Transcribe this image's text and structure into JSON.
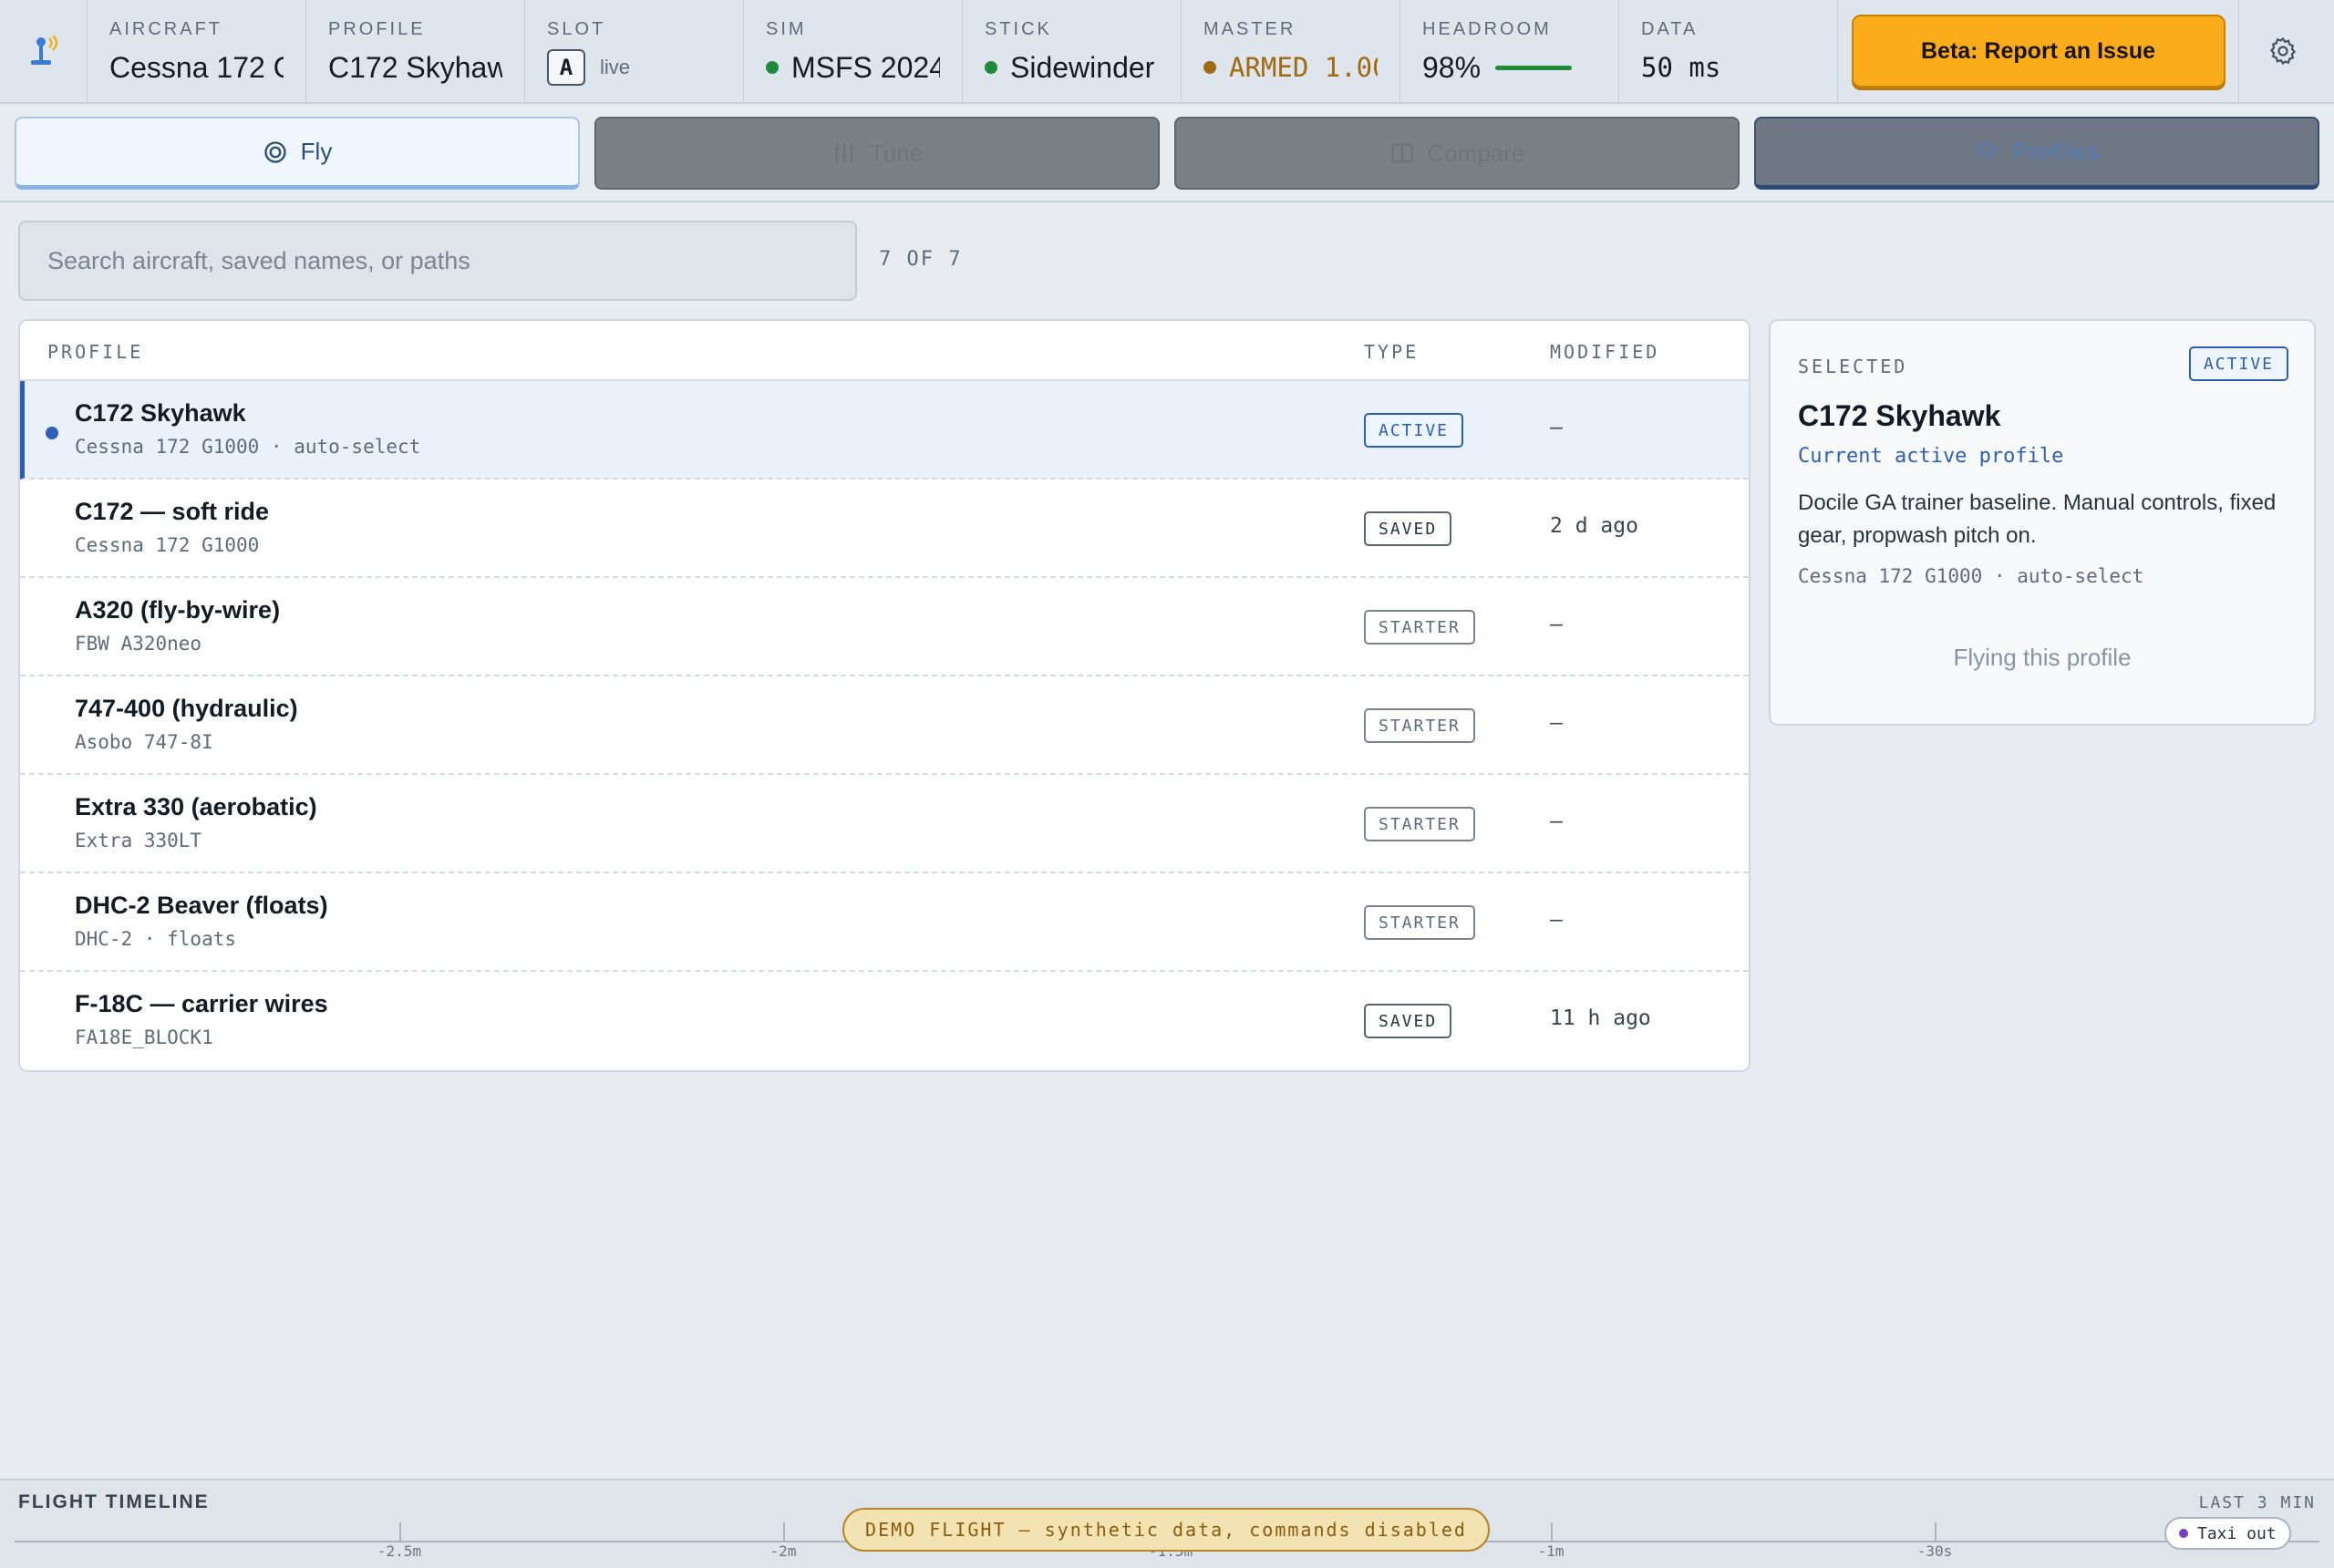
{
  "status": {
    "aircraft": {
      "label": "AIRCRAFT",
      "value": "Cessna 172 G"
    },
    "profile": {
      "label": "PROFILE",
      "value": "C172 Skyhaw"
    },
    "slot": {
      "label": "SLOT",
      "value": "A",
      "state": "live"
    },
    "sim": {
      "label": "SIM",
      "value": "MSFS 2024",
      "dot_color": "#1e8a3a"
    },
    "stick": {
      "label": "STICK",
      "value": "Sidewinder",
      "dot_color": "#1e8a3a"
    },
    "master": {
      "label": "MASTER",
      "value": "ARMED 1.00",
      "dot_color": "#a06a10"
    },
    "headroom": {
      "label": "HEADROOM",
      "value": "98%",
      "level": 0.98
    },
    "data": {
      "label": "DATA",
      "value": "50 ms"
    },
    "report_button": "Beta: Report an Issue"
  },
  "tabs": [
    {
      "label": "Fly",
      "icon": "target-icon"
    },
    {
      "label": "Tune",
      "icon": "sliders-icon"
    },
    {
      "label": "Compare",
      "icon": "columns-icon"
    },
    {
      "label": "Profiles",
      "icon": "layers-icon"
    }
  ],
  "search": {
    "placeholder": "Search aircraft, saved names, or paths",
    "count": "7 OF 7"
  },
  "table": {
    "headers": {
      "profile": "PROFILE",
      "type": "TYPE",
      "modified": "MODIFIED"
    },
    "rows": [
      {
        "name": "C172 Skyhawk",
        "sub": "Cessna 172 G1000 · auto-select",
        "type": "ACTIVE",
        "modified": "—"
      },
      {
        "name": "C172 — soft ride",
        "sub": "Cessna 172 G1000",
        "type": "SAVED",
        "modified": "2 d ago"
      },
      {
        "name": "A320 (fly-by-wire)",
        "sub": "FBW A320neo",
        "type": "STARTER",
        "modified": "—"
      },
      {
        "name": "747-400 (hydraulic)",
        "sub": "Asobo 747-8I",
        "type": "STARTER",
        "modified": "—"
      },
      {
        "name": "Extra 330 (aerobatic)",
        "sub": "Extra 330LT",
        "type": "STARTER",
        "modified": "—"
      },
      {
        "name": "DHC-2 Beaver (floats)",
        "sub": "DHC-2 · floats",
        "type": "STARTER",
        "modified": "—"
      },
      {
        "name": "F-18C — carrier wires",
        "sub": "FA18E_BLOCK1",
        "type": "SAVED",
        "modified": "11 h ago"
      }
    ]
  },
  "panel": {
    "label": "SELECTED",
    "badge": "ACTIVE",
    "title": "C172 Skyhawk",
    "subtitle": "Current active profile",
    "description": "Docile GA trainer baseline. Manual controls, fixed gear, propwash pitch on.",
    "meta": "Cessna 172 G1000 · auto-select",
    "action": "Flying this profile"
  },
  "timeline": {
    "title": "FLIGHT TIMELINE",
    "range": "LAST 3 MIN",
    "ticks": [
      "-2.5m",
      "-2m",
      "-1.5m",
      "-1m",
      "-30s"
    ],
    "banner": "DEMO FLIGHT — synthetic data, commands disabled",
    "marker": "Taxi out"
  },
  "colors": {
    "accent": "#2d5fb8",
    "report": "#fbac1a",
    "ok": "#1e8a3a",
    "armed": "#a06a10"
  }
}
